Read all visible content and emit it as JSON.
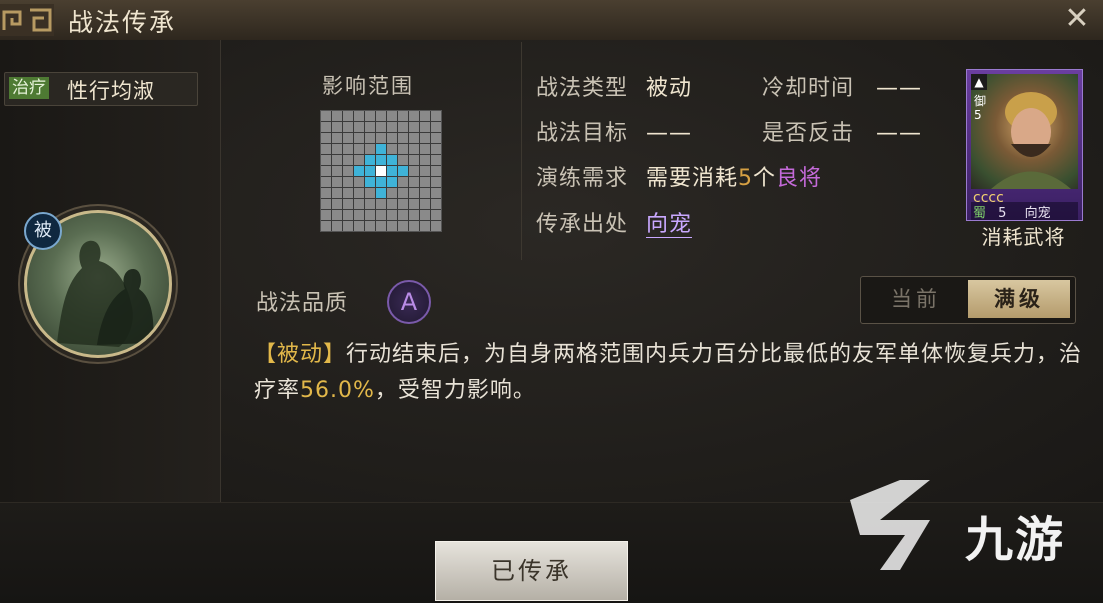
{
  "window": {
    "title": "战法传承",
    "close_icon": "close-icon"
  },
  "skill": {
    "type_tag": "治疗",
    "name": "性行均淑",
    "portrait_badge": "被"
  },
  "range": {
    "label": "影响范围",
    "grid_size": 11,
    "highlight": "diamond-radius-2",
    "colors": {
      "cell": "#8a8a8a",
      "highlight": "#3fb3d8",
      "center": "#ffffff"
    }
  },
  "info": {
    "type_label": "战法类型",
    "type_value": "被动",
    "cooldown_label": "冷却时间",
    "cooldown_value": "——",
    "target_label": "战法目标",
    "target_value": "——",
    "counter_label": "是否反击",
    "counter_value": "——",
    "train_label": "演练需求",
    "train_prefix": "需要消耗",
    "train_count": "5",
    "train_unit": "个",
    "train_item": "良将",
    "source_label": "传承出处",
    "source_value": "向宠"
  },
  "card": {
    "faction": "蜀",
    "cost": "5",
    "name": "向宠",
    "stars": "cccc",
    "side_text": "御5",
    "consume_label": "消耗武将"
  },
  "quality": {
    "label": "战法品质",
    "grade": "A"
  },
  "toggle": {
    "current": "当前",
    "full": "满级"
  },
  "description": {
    "tag": "【被动】",
    "part1": "行动结束后，为自身两格范围内兵力百分比最低的友军单体恢复兵力，治疗率",
    "rate": "56.0%",
    "part2": "，受智力影响。"
  },
  "footer": {
    "button_label": "已传承"
  },
  "watermark": {
    "text": "九游"
  }
}
